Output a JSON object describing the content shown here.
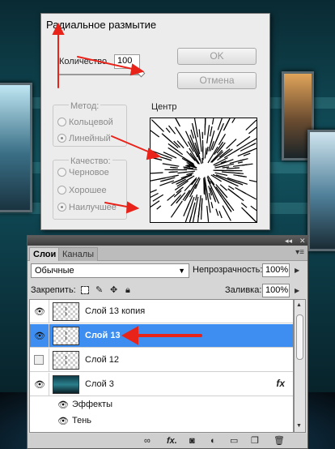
{
  "dialog": {
    "title": "Радиальное размытие",
    "amount_label": "Количество",
    "amount_value": "100",
    "amount_fraction": 1.0,
    "ok_label": "OK",
    "cancel_label": "Отмена",
    "method": {
      "label": "Метод:",
      "options": [
        "Кольцевой",
        "Линейный"
      ],
      "selected": "Линейный"
    },
    "quality": {
      "label": "Качество:",
      "options": [
        "Черновое",
        "Хорошее",
        "Наилучшее"
      ],
      "selected": "Наилучшее"
    },
    "center_label": "Центр"
  },
  "layers_panel": {
    "tabs": [
      "Слои",
      "Каналы"
    ],
    "active_tab": "Слои",
    "blend_mode": "Обычные",
    "opacity_label": "Непрозрачность:",
    "opacity_value": "100%",
    "lock_label": "Закрепить:",
    "fill_label": "Заливка:",
    "fill_value": "100%",
    "layers": [
      {
        "name": "Слой 13 копия",
        "visible": true,
        "selected": false
      },
      {
        "name": "Слой 13",
        "visible": true,
        "selected": true
      },
      {
        "name": "Слой 12",
        "visible": false,
        "selected": false
      },
      {
        "name": "Слой 3",
        "visible": true,
        "selected": false,
        "fx": "fx"
      }
    ],
    "effects_label": "Эффекты",
    "effect_item": "Тень"
  },
  "colors": {
    "selection": "#3d8ef0",
    "annotation_arrow": "#e8231a",
    "dialog_bg": "#ececec"
  }
}
